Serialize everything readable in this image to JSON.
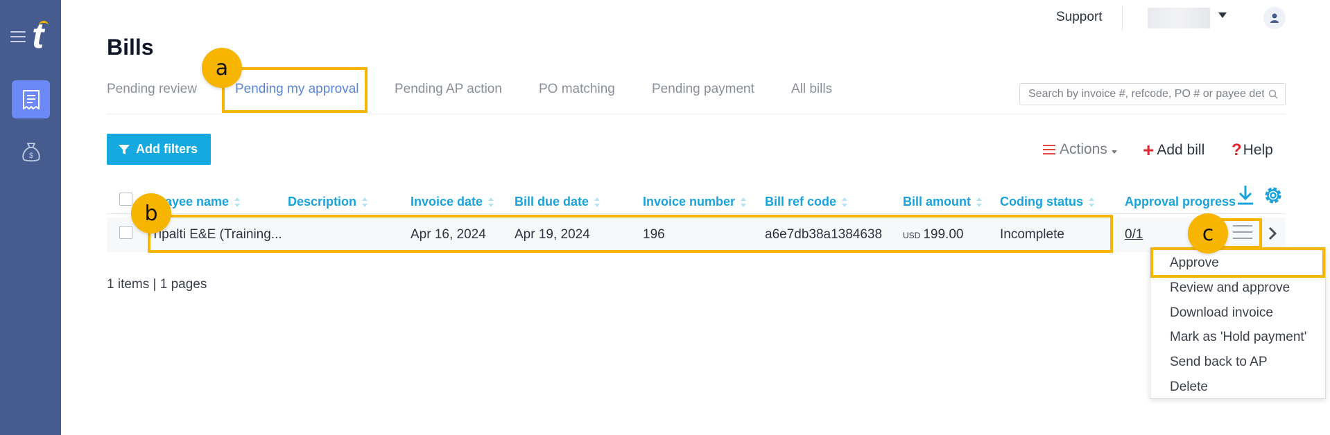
{
  "header": {
    "support": "Support"
  },
  "page": {
    "title": "Bills"
  },
  "tabs": [
    {
      "label": "Pending review"
    },
    {
      "label": "Pending my approval"
    },
    {
      "label": "Pending AP action"
    },
    {
      "label": "PO matching"
    },
    {
      "label": "Pending payment"
    },
    {
      "label": "All bills"
    }
  ],
  "search": {
    "placeholder": "Search by invoice #, refcode, PO # or payee deta"
  },
  "toolbar": {
    "add_filters": "Add filters",
    "actions": "Actions",
    "add_bill": "Add bill",
    "help": "Help"
  },
  "table": {
    "columns": [
      "Payee name",
      "Description",
      "Invoice date",
      "Bill due date",
      "Invoice number",
      "Bill ref code",
      "Bill amount",
      "Coding status",
      "Approval progress"
    ],
    "rows": [
      {
        "payee": "Tipalti E&E (Training...",
        "description": "",
        "invoice_date": "Apr 16, 2024",
        "due_date": "Apr 19, 2024",
        "invoice_number": "196",
        "ref_code": "a6e7db38a1384638",
        "currency": "USD",
        "amount": "199.00",
        "coding_status": "Incomplete",
        "approval_progress": "0/1"
      }
    ]
  },
  "pagination": "1 items | 1 pages",
  "row_menu": [
    "Approve",
    "Review and approve",
    "Download invoice",
    "Mark as 'Hold payment'",
    "Send back to AP",
    "Delete"
  ],
  "annotations": {
    "a": "a",
    "b": "b",
    "c": "c"
  },
  "colors": {
    "sidebar": "#465c8e",
    "accent": "#15a9e0",
    "highlight": "#f7b500",
    "active_tab": "#5b85d9"
  }
}
